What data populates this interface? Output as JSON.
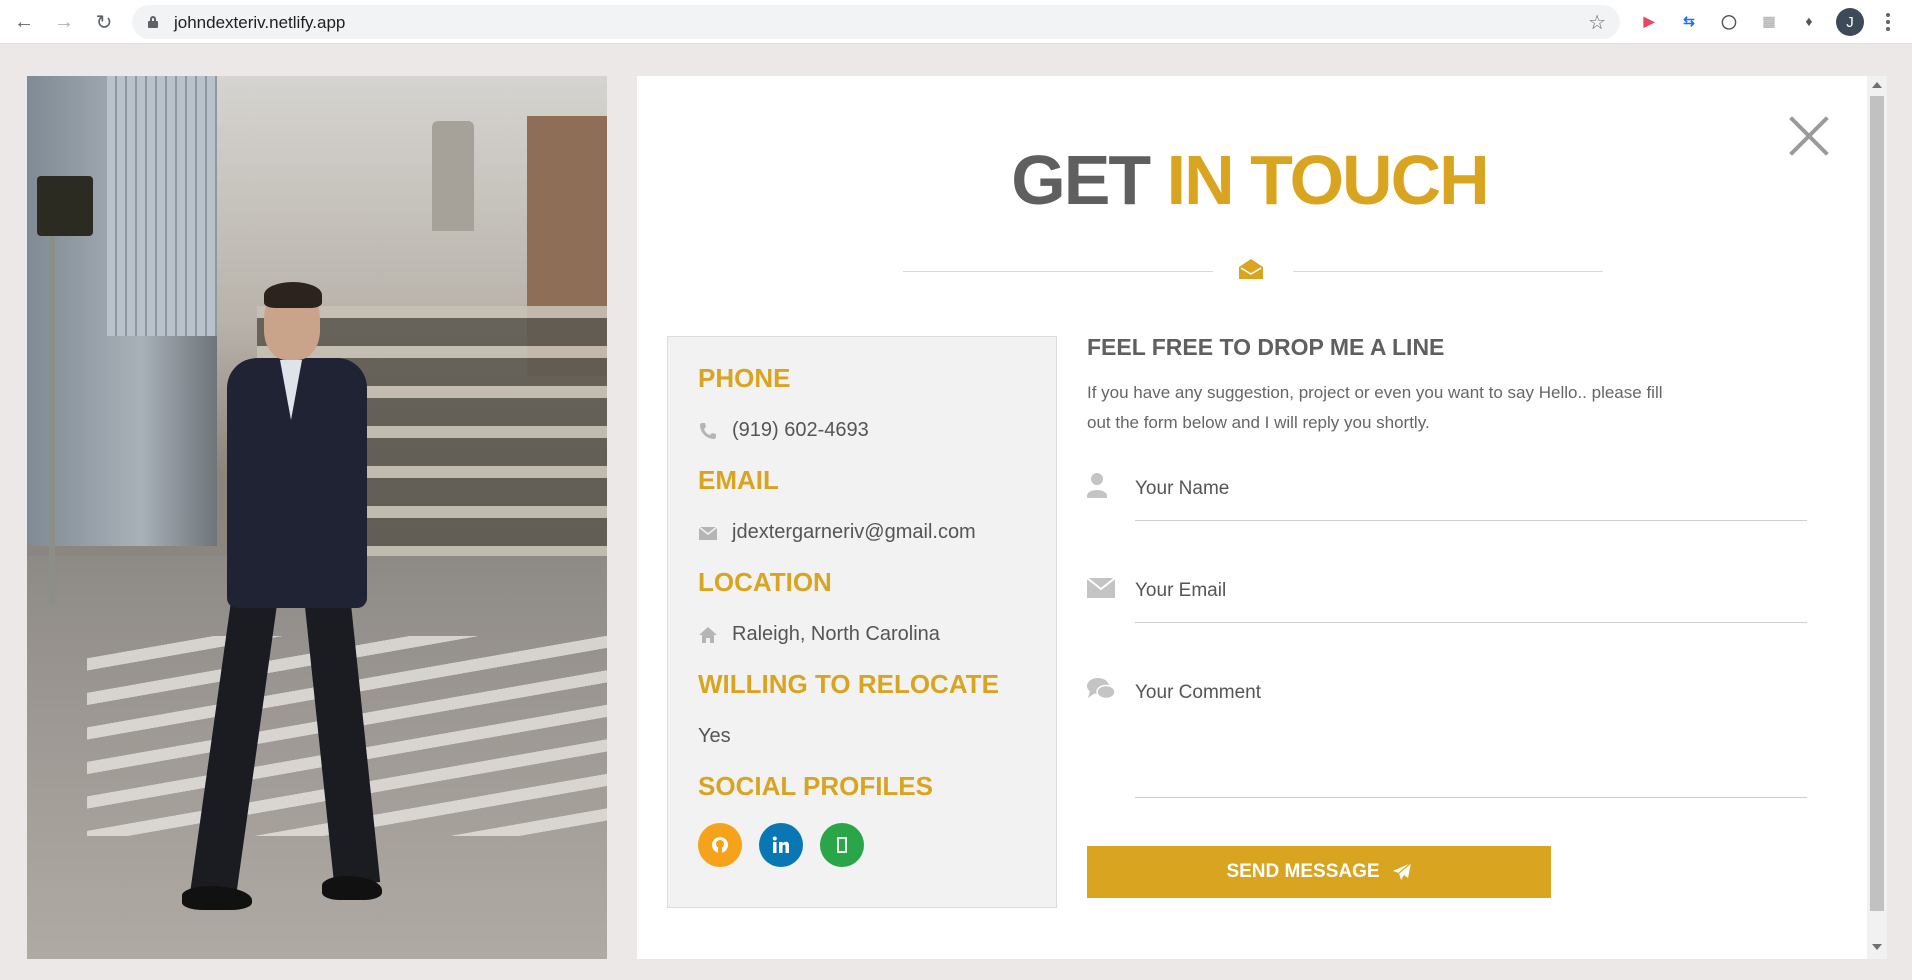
{
  "browser": {
    "url": "johndexteriv.netlify.app",
    "profile_initial": "J"
  },
  "modal": {
    "title_part1": "GET",
    "title_part2": "IN TOUCH",
    "contact_info": {
      "phone_heading": "PHONE",
      "phone": "(919) 602-4693",
      "email_heading": "EMAIL",
      "email": "jdextergarneriv@gmail.com",
      "location_heading": "LOCATION",
      "location": "Raleigh, North Carolina",
      "relocate_heading": "WILLING TO RELOCATE",
      "relocate": "Yes",
      "social_heading": "SOCIAL PROFILES",
      "social": [
        {
          "name": "github-icon",
          "color": "#f7a21b"
        },
        {
          "name": "linkedin-icon",
          "color": "#0a77b5"
        },
        {
          "name": "resume-icon",
          "color": "#2aa548"
        }
      ]
    },
    "form": {
      "heading": "FEEL FREE TO DROP ME A LINE",
      "description": "If you have any suggestion, project or even you want to say Hello.. please fill out the form below and I will reply you shortly.",
      "name_placeholder": "Your Name",
      "email_placeholder": "Your Email",
      "comment_placeholder": "Your Comment",
      "send_label": "SEND MESSAGE"
    }
  },
  "colors": {
    "accent": "#d9a520",
    "heading_gray": "#5f5f5f",
    "page_bg": "#ede8e8"
  }
}
